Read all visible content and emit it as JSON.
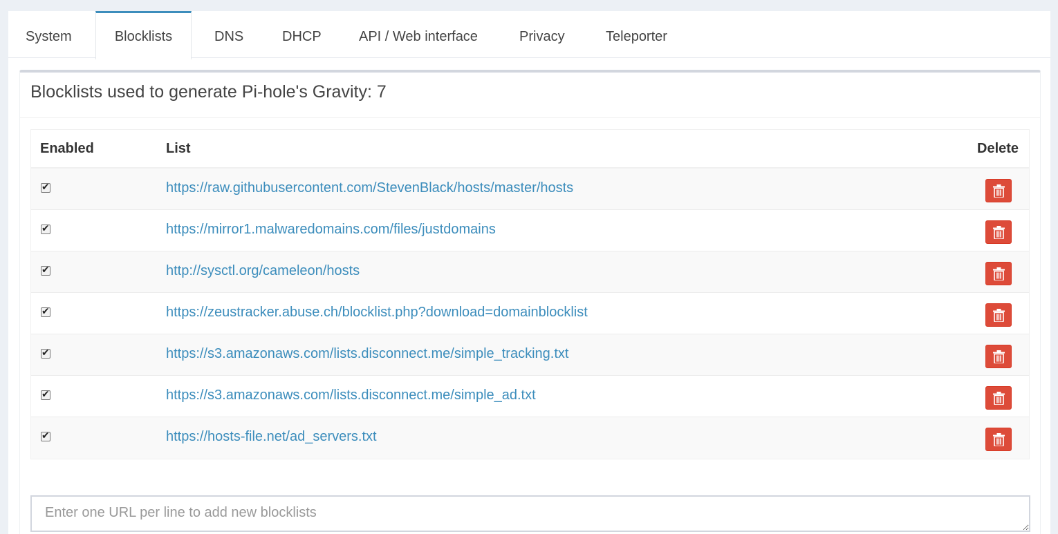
{
  "tabs": [
    {
      "label": "System",
      "active": false
    },
    {
      "label": "Blocklists",
      "active": true
    },
    {
      "label": "DNS",
      "active": false
    },
    {
      "label": "DHCP",
      "active": false
    },
    {
      "label": "API / Web interface",
      "active": false
    },
    {
      "label": "Privacy",
      "active": false
    },
    {
      "label": "Teleporter",
      "active": false
    }
  ],
  "panel": {
    "title": "Blocklists used to generate Pi-hole's Gravity: 7"
  },
  "table": {
    "headers": {
      "enabled": "Enabled",
      "list": "List",
      "delete": "Delete"
    },
    "rows": [
      {
        "enabled": true,
        "url": "https://raw.githubusercontent.com/StevenBlack/hosts/master/hosts"
      },
      {
        "enabled": true,
        "url": "https://mirror1.malwaredomains.com/files/justdomains"
      },
      {
        "enabled": true,
        "url": "http://sysctl.org/cameleon/hosts"
      },
      {
        "enabled": true,
        "url": "https://zeustracker.abuse.ch/blocklist.php?download=domainblocklist"
      },
      {
        "enabled": true,
        "url": "https://s3.amazonaws.com/lists.disconnect.me/simple_tracking.txt"
      },
      {
        "enabled": true,
        "url": "https://s3.amazonaws.com/lists.disconnect.me/simple_ad.txt"
      },
      {
        "enabled": true,
        "url": "https://hosts-file.net/ad_servers.txt"
      }
    ],
    "delete_icon": "trash-icon",
    "check_glyph": "✔"
  },
  "new_lists": {
    "value": "",
    "placeholder": "Enter one URL per line to add new blocklists"
  },
  "colors": {
    "accent": "#3c8dbc",
    "danger": "#dd4b39",
    "background": "#ecf0f5"
  }
}
